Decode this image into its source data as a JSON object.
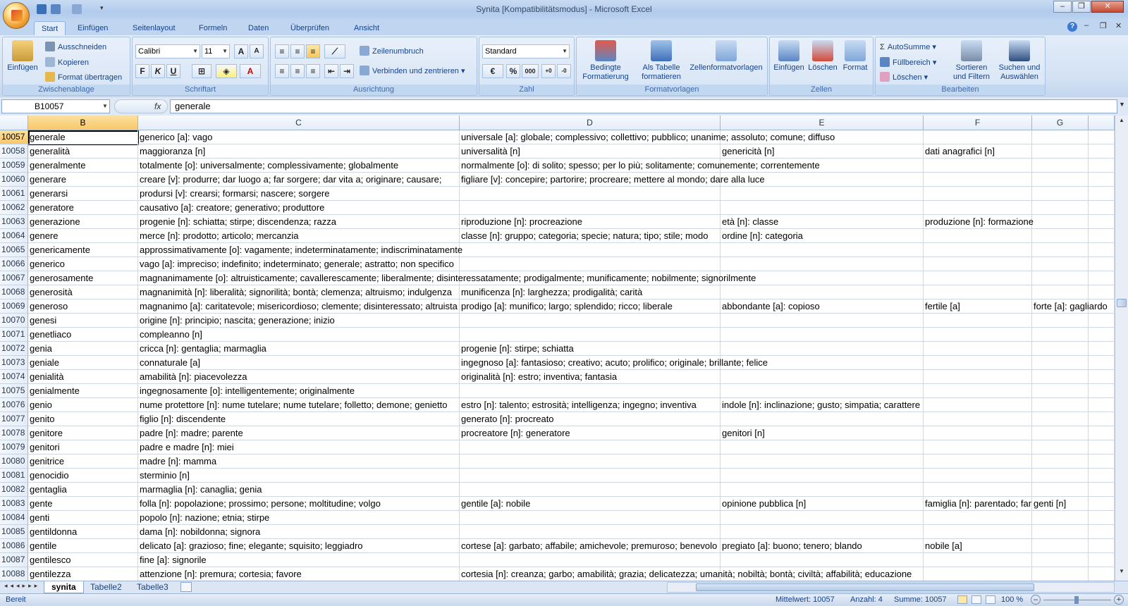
{
  "window": {
    "title": "Synita  [Kompatibilitätsmodus] - Microsoft Excel"
  },
  "tabs": [
    "Start",
    "Einfügen",
    "Seitenlayout",
    "Formeln",
    "Daten",
    "Überprüfen",
    "Ansicht"
  ],
  "ribbon": {
    "clipboard": {
      "paste": "Einfügen",
      "cut": "Ausschneiden",
      "copy": "Kopieren",
      "format_painter": "Format übertragen",
      "label": "Zwischenablage"
    },
    "font": {
      "name": "Calibri",
      "size": "11",
      "label": "Schriftart",
      "bold": "F",
      "italic": "K",
      "underline": "U"
    },
    "alignment": {
      "wrap": "Zeilenumbruch",
      "merge": "Verbinden und zentrieren",
      "label": "Ausrichtung"
    },
    "number": {
      "format": "Standard",
      "label": "Zahl",
      "percent": "%",
      "thousands": "000"
    },
    "styles": {
      "conditional": "Bedingte Formatierung",
      "as_table": "Als Tabelle formatieren",
      "cell_styles": "Zellenformatvorlagen",
      "label": "Formatvorlagen"
    },
    "cells": {
      "insert": "Einfügen",
      "delete": "Löschen",
      "format": "Format",
      "label": "Zellen"
    },
    "editing": {
      "autosum": "AutoSumme",
      "fill": "Füllbereich",
      "clear": "Löschen",
      "sort": "Sortieren und Filtern",
      "find": "Suchen und Auswählen",
      "label": "Bearbeiten"
    }
  },
  "formula_bar": {
    "name_box": "B10057",
    "fx": "fx",
    "value": "generale"
  },
  "columns": [
    "B",
    "C",
    "D",
    "E",
    "F",
    "G"
  ],
  "rows": [
    {
      "n": "10057",
      "b": "generale",
      "c": "generico [a]: vago",
      "d": "universale [a]: globale; complessivo; collettivo; pubblico; unanime; assoluto; comune; diffuso",
      "e": "",
      "f": "",
      "g": ""
    },
    {
      "n": "10058",
      "b": "generalità",
      "c": "maggioranza [n]",
      "d": "universalità [n]",
      "e": "genericità [n]",
      "f": "dati anagrafici [n]",
      "g": ""
    },
    {
      "n": "10059",
      "b": "generalmente",
      "c": "totalmente [o]: universalmente; complessivamente; globalmente",
      "d": "normalmente [o]: di solito; spesso; per lo più; solitamente; comunemente; correntemente",
      "e": "",
      "f": "",
      "g": ""
    },
    {
      "n": "10060",
      "b": "generare",
      "c": "creare [v]: produrre; dar luogo a; far sorgere; dar vita a; originare; causare; ",
      "d": "figliare [v]: concepire; partorire; procreare; mettere al mondo; dare alla luce",
      "e": "",
      "f": "",
      "g": ""
    },
    {
      "n": "10061",
      "b": "generarsi",
      "c": "prodursi [v]: crearsi; formarsi; nascere; sorgere",
      "d": "",
      "e": "",
      "f": "",
      "g": ""
    },
    {
      "n": "10062",
      "b": "generatore",
      "c": "causativo [a]: creatore; generativo; produttore",
      "d": "",
      "e": "",
      "f": "",
      "g": ""
    },
    {
      "n": "10063",
      "b": "generazione",
      "c": "progenie [n]: schiatta; stirpe; discendenza; razza",
      "d": "riproduzione [n]: procreazione",
      "e": "età [n]: classe",
      "f": "produzione [n]: formazione",
      "g": ""
    },
    {
      "n": "10064",
      "b": "genere",
      "c": "merce [n]: prodotto; articolo; mercanzia",
      "d": "classe [n]: gruppo; categoria; specie; natura; tipo; stile; modo",
      "e": "ordine [n]: categoria",
      "f": "",
      "g": ""
    },
    {
      "n": "10065",
      "b": "genericamente",
      "c": "approssimativamente [o]: vagamente; indeterminatamente; indiscriminatamente",
      "d": "",
      "e": "",
      "f": "",
      "g": ""
    },
    {
      "n": "10066",
      "b": "generico",
      "c": "vago [a]: impreciso; indefinito; indeterminato; generale; astratto; non specifico",
      "d": "",
      "e": "",
      "f": "",
      "g": ""
    },
    {
      "n": "10067",
      "b": "generosamente",
      "c": "magnanimamente [o]: altruisticamente; cavallerescamente; liberalmente; disinteressatamente; prodigalmente; munificamente; nobilmente; signorilmente",
      "d": "",
      "e": "",
      "f": "",
      "g": ""
    },
    {
      "n": "10068",
      "b": "generosità",
      "c": "magnanimità [n]: liberalità; signorilità; bontà; clemenza; altruismo; indulgenza",
      "d": "munificenza [n]: larghezza; prodigalità; carità",
      "e": "",
      "f": "",
      "g": ""
    },
    {
      "n": "10069",
      "b": "generoso",
      "c": "magnanimo [a]: caritatevole; misericordioso; clemente; disinteressato; altruista",
      "d": "prodigo [a]: munifico; largo; splendido; ricco; liberale",
      "e": "abbondante [a]: copioso",
      "f": "fertile [a]",
      "g": "forte [a]: gagliardo"
    },
    {
      "n": "10070",
      "b": "genesi",
      "c": "origine [n]: principio; nascita; generazione; inizio",
      "d": "",
      "e": "",
      "f": "",
      "g": ""
    },
    {
      "n": "10071",
      "b": "genetliaco",
      "c": "compleanno [n]",
      "d": "",
      "e": "",
      "f": "",
      "g": ""
    },
    {
      "n": "10072",
      "b": "genia",
      "c": "cricca [n]: gentaglia; marmaglia",
      "d": "progenie [n]: stirpe; schiatta",
      "e": "",
      "f": "",
      "g": ""
    },
    {
      "n": "10073",
      "b": "geniale",
      "c": "connaturale [a]",
      "d": "ingegnoso [a]: fantasioso; creativo; acuto; prolifico; originale; brillante; felice",
      "e": "",
      "f": "",
      "g": ""
    },
    {
      "n": "10074",
      "b": "genialità",
      "c": "amabilità [n]: piacevolezza",
      "d": "originalità [n]: estro; inventiva; fantasia",
      "e": "",
      "f": "",
      "g": ""
    },
    {
      "n": "10075",
      "b": "genialmente",
      "c": "ingegnosamente [o]: intelligentemente; originalmente",
      "d": "",
      "e": "",
      "f": "",
      "g": ""
    },
    {
      "n": "10076",
      "b": "genio",
      "c": "nume protettore [n]: nume tutelare; nume tutelare; folletto; demone; genietto",
      "d": "estro [n]: talento; estrosità; intelligenza; ingegno; inventiva",
      "e": "indole [n]: inclinazione; gusto; simpatia; carattere",
      "f": "",
      "g": ""
    },
    {
      "n": "10077",
      "b": "genito",
      "c": "figlio [n]: discendente",
      "d": "generato [n]: procreato",
      "e": "",
      "f": "",
      "g": ""
    },
    {
      "n": "10078",
      "b": "genitore",
      "c": "padre [n]: madre; parente",
      "d": "procreatore [n]: generatore",
      "e": "genitori [n]",
      "f": "",
      "g": ""
    },
    {
      "n": "10079",
      "b": "genitori",
      "c": "padre e madre [n]: miei",
      "d": "",
      "e": "",
      "f": "",
      "g": ""
    },
    {
      "n": "10080",
      "b": "genitrice",
      "c": "madre [n]: mamma",
      "d": "",
      "e": "",
      "f": "",
      "g": ""
    },
    {
      "n": "10081",
      "b": "genocidio",
      "c": "sterminio [n]",
      "d": "",
      "e": "",
      "f": "",
      "g": ""
    },
    {
      "n": "10082",
      "b": "gentaglia",
      "c": "marmaglia [n]: canaglia; genia",
      "d": "",
      "e": "",
      "f": "",
      "g": ""
    },
    {
      "n": "10083",
      "b": "gente",
      "c": "folla [n]: popolazione; prossimo; persone; moltitudine; volgo",
      "d": "gentile [a]: nobile",
      "e": "opinione pubblica [n]",
      "f": "famiglia [n]: parentado; famiglia",
      "g": "genti [n]"
    },
    {
      "n": "10084",
      "b": "genti",
      "c": "popolo [n]: nazione; etnia; stirpe",
      "d": "",
      "e": "",
      "f": "",
      "g": ""
    },
    {
      "n": "10085",
      "b": "gentildonna",
      "c": "dama [n]: nobildonna; signora",
      "d": "",
      "e": "",
      "f": "",
      "g": ""
    },
    {
      "n": "10086",
      "b": "gentile",
      "c": "delicato [a]: grazioso; fine; elegante; squisito; leggiadro",
      "d": "cortese [a]: garbato; affabile; amichevole; premuroso; benevolo",
      "e": "pregiato [a]: buono; tenero; blando",
      "f": "nobile [a]",
      "g": ""
    },
    {
      "n": "10087",
      "b": "gentilesco",
      "c": "fine [a]: signorile",
      "d": "",
      "e": "",
      "f": "",
      "g": ""
    },
    {
      "n": "10088",
      "b": "gentilezza",
      "c": "attenzione [n]: premura; cortesia; favore",
      "d": "cortesia [n]: creanza; garbo; amabilità; grazia; delicatezza; umanità; nobiltà; bontà; civiltà; affabilità; educazione",
      "e": "",
      "f": "",
      "g": ""
    }
  ],
  "sheet_tabs": [
    "synita",
    "Tabelle2",
    "Tabelle3"
  ],
  "status": {
    "ready": "Bereit",
    "average": "Mittelwert: 10057",
    "count": "Anzahl: 4",
    "sum": "Summe: 10057",
    "zoom": "100 %"
  },
  "colors": {
    "selection_header": "#f9c769",
    "ribbon_bg": "#dfe8f5",
    "text_blue": "#15428b"
  }
}
